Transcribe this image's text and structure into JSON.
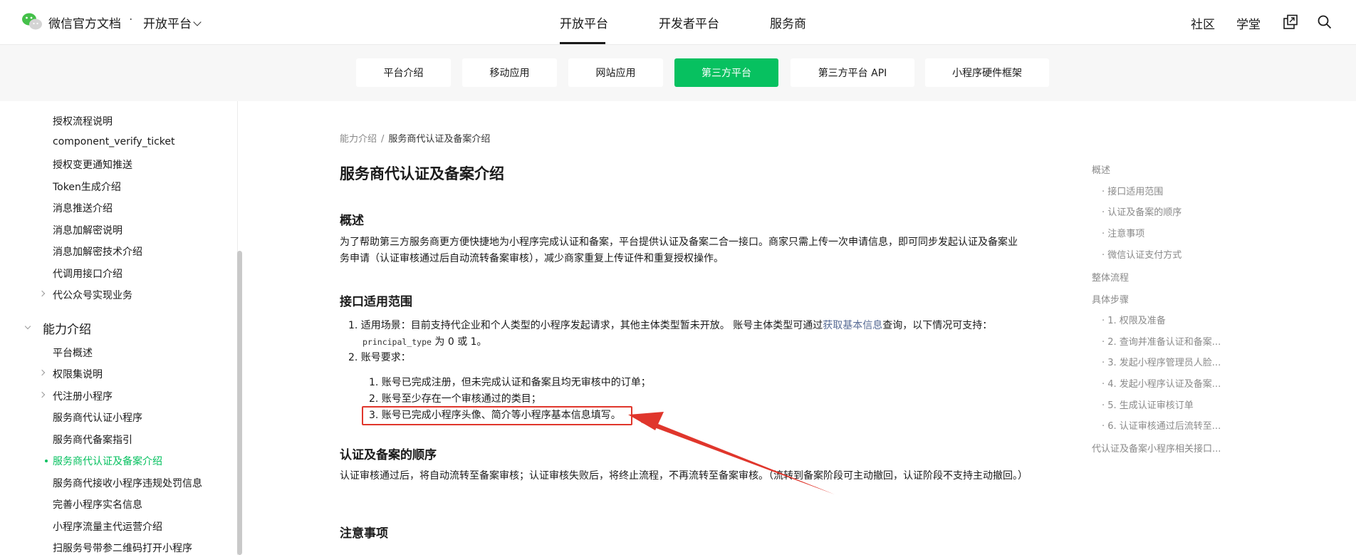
{
  "header": {
    "brand": "微信官方文档",
    "dot": "·",
    "platform_selector": "开放平台",
    "nav": [
      "开放平台",
      "开发者平台",
      "服务商"
    ],
    "right": [
      "社区",
      "学堂"
    ]
  },
  "subnav": {
    "tabs": [
      "平台介绍",
      "移动应用",
      "网站应用",
      "第三方平台",
      "第三方平台 API",
      "小程序硬件框架"
    ],
    "active_index": 3
  },
  "sidebar": {
    "items_top": [
      "授权流程说明",
      "component_verify_ticket",
      "授权变更通知推送",
      "Token生成介绍",
      "消息推送介绍",
      "消息加解密说明",
      "消息加解密技术介绍",
      "代调用接口介绍",
      "代公众号实现业务"
    ],
    "section": "能力介绍",
    "items_section": [
      "平台概述",
      "权限集说明",
      "代注册小程序",
      "服务商代认证小程序",
      "服务商代备案指引",
      "服务商代认证及备案介绍",
      "服务商代接收小程序违规处罚信息",
      "完善小程序实名信息",
      "小程序流量主代运营介绍",
      "扫服务号带参二维码打开小程序"
    ]
  },
  "breadcrumb": {
    "parent": "能力介绍",
    "sep": "/",
    "current": "服务商代认证及备案介绍"
  },
  "content": {
    "title": "服务商代认证及备案介绍",
    "overview_h": "概述",
    "overview_p": "为了帮助第三方服务商更方便快捷地为小程序完成认证和备案，平台提供认证及备案二合一接口。商家只需上传一次申请信息，即可同步发起认证及备案业务申请（认证审核通过后自动流转备案审核），减少商家重复上传证件和重复授权操作。",
    "scope_h": "接口适用范围",
    "scope_1_a": "1. 适用场景：目前支持代企业和个人类型的小程序发起请求，其他主体类型暂未开放。 账号主体类型可通过",
    "scope_1_link": "获取基本信息",
    "scope_1_b": "查询，以下情况可支持：",
    "scope_1_code": "principal_type",
    "scope_1_c": " 为 0 或 1。",
    "scope_2": "2. 账号要求：",
    "req_1": "1. 账号已完成注册，但未完成认证和备案且均无审核中的订单；",
    "req_2": "2. 账号至少存在一个审核通过的类目；",
    "req_3": "3. 账号已完成小程序头像、简介等小程序基本信息填写。",
    "order_h": "认证及备案的顺序",
    "order_p": "认证审核通过后，将自动流转至备案审核；认证审核失败后，将终止流程，不再流转至备案审核。（流转到备案阶段可主动撤回，认证阶段不支持主动撤回。）",
    "notes_h": "注意事项"
  },
  "toc": [
    "概述",
    "· 接口适用范围",
    "· 认证及备案的顺序",
    "· 注意事项",
    "· 微信认证支付方式",
    "整体流程",
    "具体步骤",
    "· 1. 权限及准备",
    "· 2. 查询并准备认证和备案...",
    "· 3. 发起小程序管理员人脸...",
    "· 4. 发起小程序认证及备案...",
    "· 5. 生成认证审核订单",
    "· 6. 认证审核通过后流转至...",
    "代认证及备案小程序相关接口..."
  ],
  "colors": {
    "accent": "#07c160",
    "link": "#576b95",
    "annotation": "#e0362c"
  }
}
